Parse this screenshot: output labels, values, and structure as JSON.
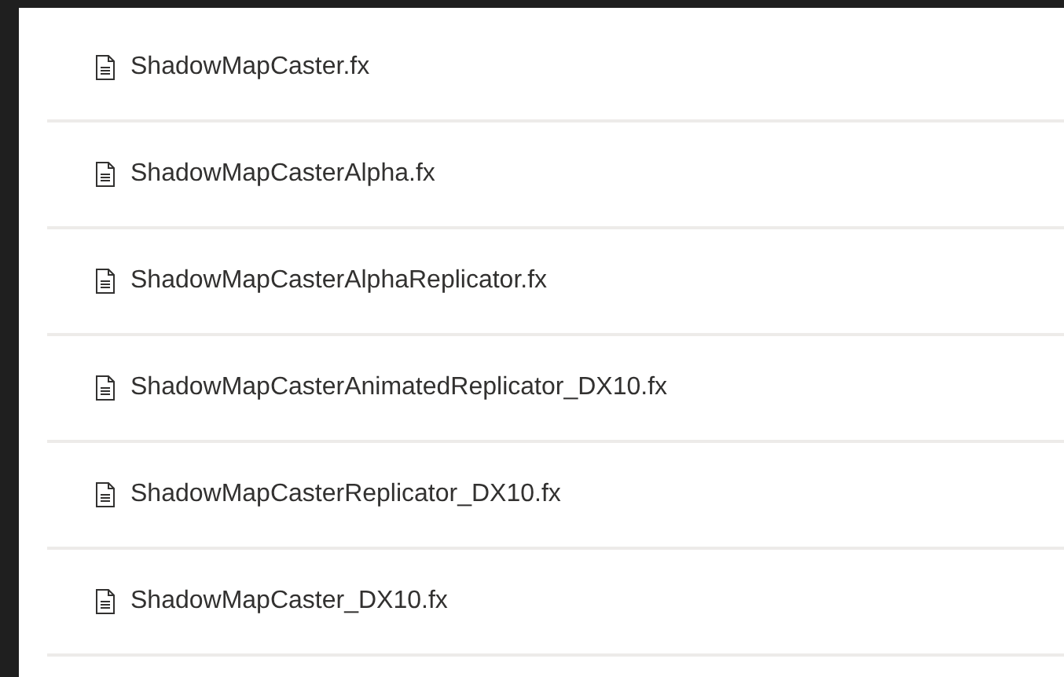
{
  "files": [
    {
      "name": "ShadowMapCaster.fx"
    },
    {
      "name": "ShadowMapCasterAlpha.fx"
    },
    {
      "name": "ShadowMapCasterAlphaReplicator.fx"
    },
    {
      "name": "ShadowMapCasterAnimatedReplicator_DX10.fx"
    },
    {
      "name": "ShadowMapCasterReplicator_DX10.fx"
    },
    {
      "name": "ShadowMapCaster_DX10.fx"
    }
  ]
}
